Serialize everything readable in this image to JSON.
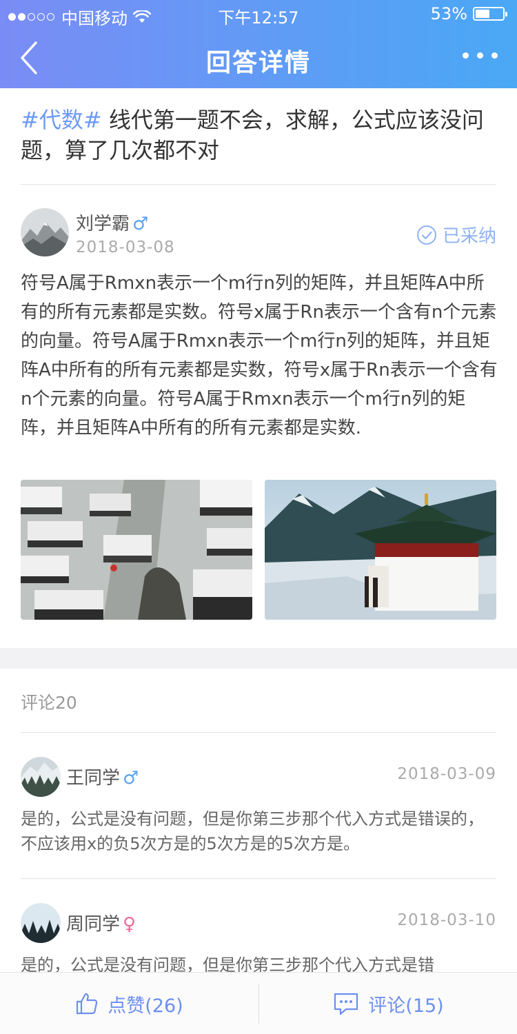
{
  "status_bar": {
    "carrier": "中国移动",
    "time": "下午12:57",
    "battery": "53%",
    "battery_level": 0.53
  },
  "nav": {
    "title": "回答详情"
  },
  "question": {
    "tag": "#代数#",
    "text": " 线代第一题不会，求解，公式应该没问题，算了几次都不对"
  },
  "answer": {
    "author": "刘学霸",
    "gender_symbol": "♂",
    "date": "2018-03-08",
    "accepted_label": "已采纳",
    "body": "符号A属于Rmxn表示一个m行n列的矩阵，并且矩阵A中所有的所有元素都是实数。符号x属于Rn表示一个含有n个元素的向量。符号A属于Rmxn表示一个m行n列的矩阵，并且矩阵A中所有的所有元素都是实数，符号x属于Rn表示一个含有n个元素的向量。符号A属于Rmxn表示一个m行n列的矩阵，并且矩阵A中所有的所有元素都是实数."
  },
  "comments_header": "评论20",
  "comments": [
    {
      "name": "王同学",
      "gender_symbol": "♂",
      "date": "2018-03-09",
      "text": "是的，公式是没有问题，但是你第三步那个代入方式是错误的，不应该用x的负5次方是的5次方是的5次方是。"
    },
    {
      "name": "周同学",
      "gender_symbol": "♀",
      "date": "2018-03-10",
      "text": "是的，公式是没有问题，但是你第三步那个代入方式是错"
    }
  ],
  "bottom_bar": {
    "like_label": "点赞(26)",
    "comment_label": "评论(15)"
  },
  "colors": {
    "header_start": "#7a8cf5",
    "header_end": "#4aa8f5",
    "accent": "#6d9bf5",
    "male": "#5aa3f2",
    "female": "#f06a93"
  }
}
